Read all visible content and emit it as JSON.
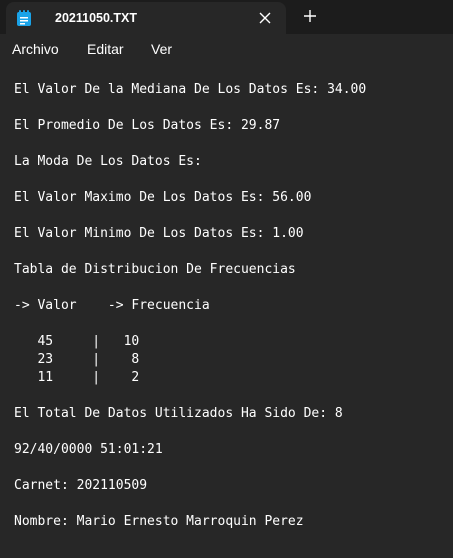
{
  "tab": {
    "title": "20211050.TXT",
    "icon": "notepad-icon",
    "close_icon": "close-icon",
    "new_tab_icon": "plus-icon"
  },
  "menu": {
    "items": [
      "Archivo",
      "Editar",
      "Ver"
    ]
  },
  "document": {
    "lines": [
      "El Valor De la Mediana De Los Datos Es: 34.00",
      "El Promedio De Los Datos Es: 29.87",
      "La Moda De Los Datos Es:",
      "El Valor Maximo De Los Datos Es: 56.00",
      "El Valor Minimo De Los Datos Es: 1.00",
      "Tabla de Distribucion De Frecuencias",
      "-> Valor    -> Frecuencia",
      "   45     |   10",
      "   23     |    8",
      "   11     |    2",
      "El Total De Datos Utilizados Ha Sido De: 8",
      "92/40/0000 51:01:21",
      "Carnet: 202110509",
      "Nombre: Mario Ernesto Marroquin Perez"
    ]
  },
  "colors": {
    "background": "#272727",
    "titlebar": "#1c1c1c",
    "text": "#ffffff",
    "icon_accent": "#1aa3e8"
  }
}
